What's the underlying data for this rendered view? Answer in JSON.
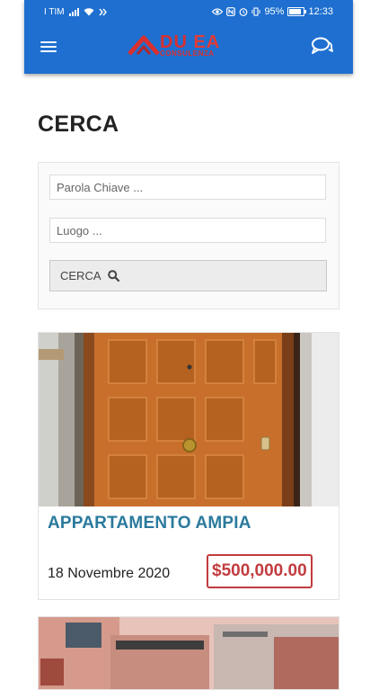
{
  "status_bar": {
    "carrier": "I TIM",
    "battery": "95%",
    "time": "12:33"
  },
  "header": {
    "logo_main": "DUEA",
    "logo_sub": "CONSULENZA"
  },
  "page": {
    "title": "CERCA"
  },
  "search": {
    "keyword_placeholder": "Parola Chiave ...",
    "location_placeholder": "Luogo ...",
    "button_label": "CERCA"
  },
  "listings": [
    {
      "title": "APPARTAMENTO AMPIA",
      "date": "18 Novembre 2020",
      "price": "$500,000.00"
    }
  ],
  "colors": {
    "brand_blue": "#1e6fd0",
    "title_teal": "#2a7a9c",
    "price_red": "#c23b3f",
    "logo_red": "#d9302f"
  },
  "icons": [
    "menu-icon",
    "chat-icon",
    "search-icon",
    "wifi-icon",
    "signal-icon",
    "battery-icon",
    "alarm-icon",
    "eye-icon",
    "nfc-icon"
  ]
}
